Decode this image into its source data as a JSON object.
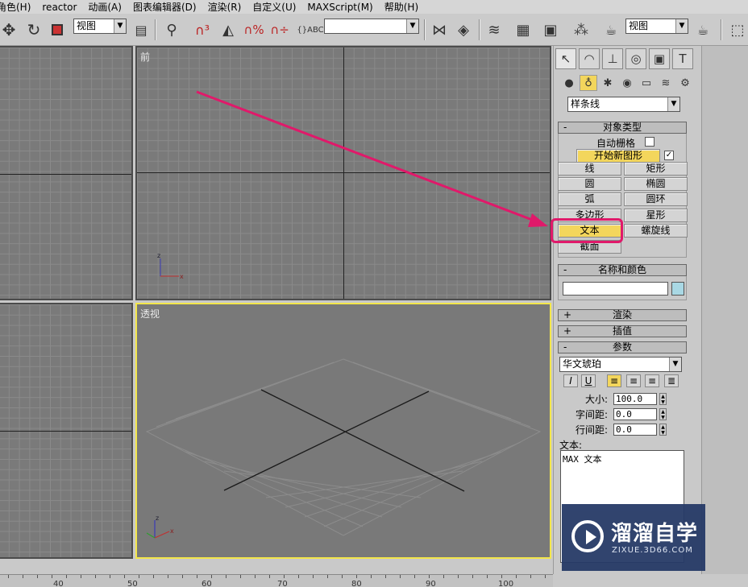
{
  "menubar": {
    "items": [
      "角色(H)",
      "reactor",
      "动画(A)",
      "图表编辑器(D)",
      "渲染(R)",
      "自定义(U)",
      "MAXScript(M)",
      "帮助(H)"
    ]
  },
  "toolbar": {
    "view_dropdown_1": "视图",
    "named_selection": "",
    "view_dropdown_2": "视图",
    "icons": [
      "move-icon",
      "rotate-icon",
      "scale-icon",
      "mirror-icon",
      "snap-icon",
      "angle-snap-icon",
      "percent-snap-icon",
      "spinner-snap-icon",
      "abc-icon",
      "align-icon",
      "layer-icon",
      "curve-editor-icon",
      "schematic-icon",
      "material-editor-icon",
      "render-setup-icon",
      "teapot-render-icon",
      "quick-render-icon"
    ]
  },
  "viewports": {
    "front_label": "前",
    "perspective_label": "透视",
    "axis_x": "x",
    "axis_z": "z"
  },
  "panel": {
    "category_dropdown": "样条线",
    "object_type": {
      "title": "对象类型",
      "collapse": "-",
      "auto_grid": "自动栅格",
      "start_new_shape": "开始新图形",
      "buttons": [
        "线",
        "矩形",
        "圆",
        "椭圆",
        "弧",
        "圆环",
        "多边形",
        "星形",
        "文本",
        "螺旋线",
        "截面"
      ]
    },
    "name_color": {
      "title": "名称和颜色",
      "collapse": "-",
      "name_value": "",
      "swatch_color": "#a9d8e4"
    },
    "rendering": {
      "title": "渲染",
      "sign": "+"
    },
    "interpolation": {
      "title": "插值",
      "sign": "+"
    },
    "parameters": {
      "title": "参数",
      "sign": "-",
      "font": "华文琥珀",
      "italic": "I",
      "underline": "U",
      "size_label": "大小:",
      "size_value": "100.0",
      "kerning_label": "字间距:",
      "kerning_value": "0.0",
      "leading_label": "行间距:",
      "leading_value": "0.0",
      "text_label": "文本:",
      "text_value": "MAX 文本"
    }
  },
  "timeline": {
    "tick_labels": [
      "40",
      "50",
      "60",
      "70",
      "80",
      "90",
      "100"
    ]
  },
  "watermark": {
    "title": "溜溜自学",
    "subtitle": "ZIXUE.3D66.COM"
  },
  "colors": {
    "highlight": "#f3d65c",
    "active_viewport": "#f3e64a",
    "annotation": "#e0196a"
  }
}
